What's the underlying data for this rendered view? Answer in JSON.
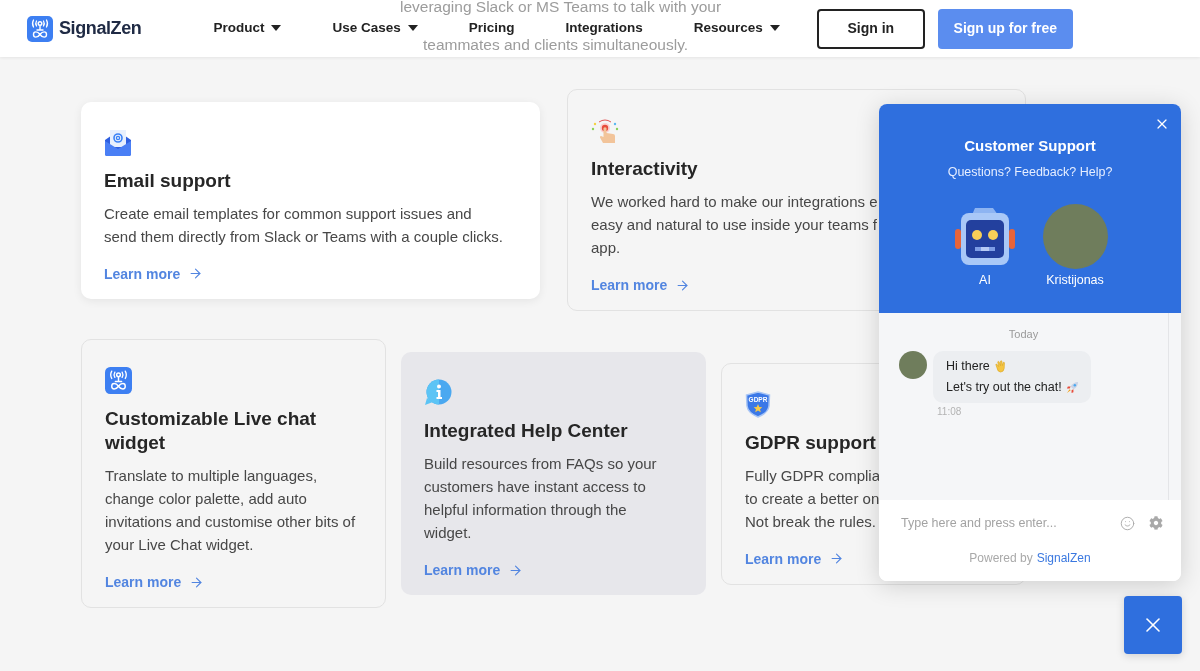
{
  "background_text": {
    "line_1": "leveraging Slack or MS Teams to talk with your",
    "line_2": "teammates and clients simultaneously."
  },
  "header": {
    "logo_text": "SignalZen",
    "nav": [
      {
        "label": "Product",
        "dropdown": true
      },
      {
        "label": "Use Cases",
        "dropdown": true
      },
      {
        "label": "Pricing",
        "dropdown": false
      },
      {
        "label": "Integrations",
        "dropdown": false
      },
      {
        "label": "Resources",
        "dropdown": true
      }
    ],
    "sign_in": "Sign in",
    "sign_up": "Sign up for free"
  },
  "card_rows": [
    {
      "cards": [
        {
          "kind": "raised",
          "title": "Email support",
          "description_lines": [
            "Create email templates for common support issues and",
            "send them directly from Slack or Teams with a couple clicks."
          ],
          "link": "Learn more"
        },
        {
          "kind": "outlined",
          "title": "Interactivity",
          "description_lines": [
            "We worked hard to make our integrations e",
            "easy and natural to use inside your teams f",
            "app."
          ],
          "link": "Learn more"
        }
      ]
    },
    {
      "cards": [
        {
          "kind": "outlined",
          "title": "Customizable Live chat widget",
          "description_lines": [
            "Translate to multiple languages,",
            "change color palette, add auto",
            "invitations and customise other bits of",
            "your Live Chat widget."
          ],
          "link": "Learn more"
        },
        {
          "kind": "shaded",
          "title": "Integrated Help Center",
          "description_lines": [
            "Build resources from FAQs so your",
            "customers have instant access to",
            "helpful information through the",
            "widget."
          ],
          "link": "Learn more"
        },
        {
          "kind": "outlined",
          "title": "GDPR support",
          "icon_text": "GDPR",
          "description_lines": [
            "Fully GDPR complia",
            "to create a better on",
            "Not break the rules."
          ],
          "link": "Learn more"
        }
      ]
    }
  ],
  "chat": {
    "title": "Customer Support",
    "subtitle": "Questions? Feedback? Help?",
    "agents": [
      {
        "kind": "bot",
        "name": "AI"
      },
      {
        "kind": "person",
        "name": "Kristijonas"
      }
    ],
    "day_label": "Today",
    "message": {
      "lines": [
        "Hi there",
        "Let's try out the chat!"
      ],
      "time": "11:08"
    },
    "input": {
      "placeholder": "Type here and press enter..."
    },
    "footer": {
      "label": "Powered by",
      "link": "SignalZen"
    }
  }
}
